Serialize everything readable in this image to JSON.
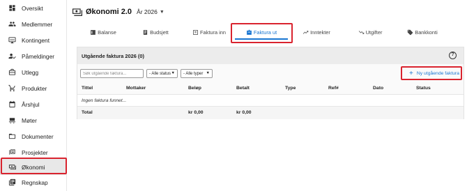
{
  "sidebar": {
    "items": [
      {
        "label": "Oversikt",
        "icon": "dashboard-icon"
      },
      {
        "label": "Medlemmer",
        "icon": "people-icon"
      },
      {
        "label": "Kontingent",
        "icon": "monitor-icon"
      },
      {
        "label": "Påmeldinger",
        "icon": "person-check-icon"
      },
      {
        "label": "Utlegg",
        "icon": "wallet-icon"
      },
      {
        "label": "Produkter",
        "icon": "cart-icon"
      },
      {
        "label": "Årshjul",
        "icon": "calendar-icon"
      },
      {
        "label": "Møter",
        "icon": "meeting-icon"
      },
      {
        "label": "Dokumenter",
        "icon": "folder-icon"
      },
      {
        "label": "Prosjekter",
        "icon": "layers-icon"
      },
      {
        "label": "Økonomi",
        "icon": "money-icon"
      },
      {
        "label": "Regnskap",
        "icon": "ledger-icon"
      }
    ],
    "active_index": 10
  },
  "header": {
    "title": "Økonomi 2.0",
    "year": "År 2026"
  },
  "tabs": [
    {
      "label": "Balanse",
      "icon": "balance-icon"
    },
    {
      "label": "Budsjett",
      "icon": "budget-icon"
    },
    {
      "label": "Faktura inn",
      "icon": "invoice-in-icon"
    },
    {
      "label": "Faktura ut",
      "icon": "invoice-out-icon"
    },
    {
      "label": "Inntekter",
      "icon": "trend-up-icon"
    },
    {
      "label": "Utgifter",
      "icon": "trend-down-icon"
    },
    {
      "label": "Bankkonti",
      "icon": "tag-icon"
    }
  ],
  "active_tab": 3,
  "panel": {
    "title": "Utgående faktura 2026 (0)",
    "help": "?",
    "search_placeholder": "Søk utgående faktura...",
    "status_filter": "- Alle status",
    "type_filter": "- Alle typer",
    "add_plus": "+",
    "add_label": "Ny utgående faktura"
  },
  "table": {
    "columns": [
      "Tittel",
      "Mottaker",
      "Beløp",
      "Betalt",
      "Type",
      "Ref#",
      "Dato",
      "Status"
    ],
    "empty_message": "Ingen faktura funnet...",
    "total_label": "Total",
    "total_amount": "kr 0,00",
    "total_paid": "kr 0,00"
  },
  "colors": {
    "accent": "#1976d2",
    "highlight": "#d9232e"
  }
}
